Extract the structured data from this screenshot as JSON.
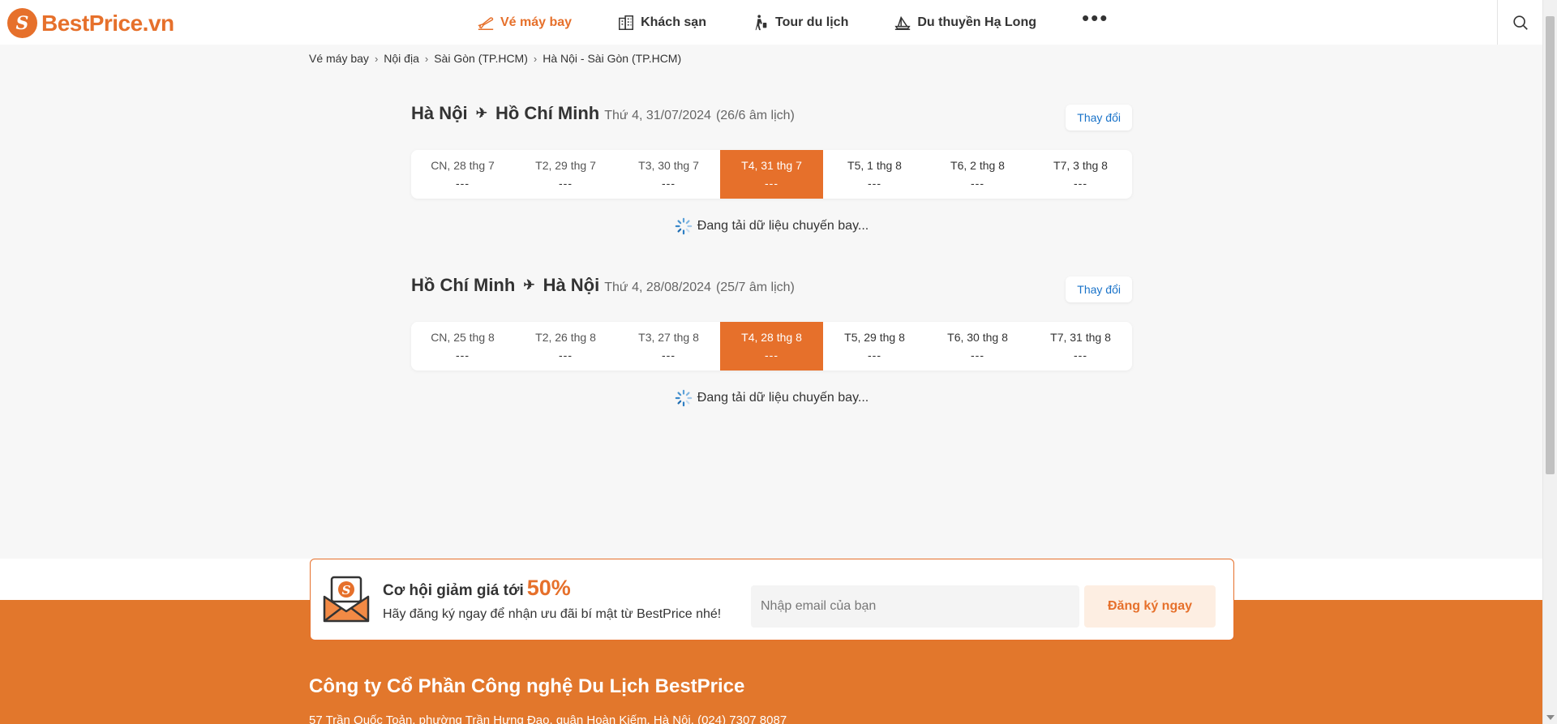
{
  "brand": {
    "name": "BestPrice.vn",
    "logo_letter": "S"
  },
  "nav": {
    "items": [
      {
        "label": "Vé máy bay",
        "icon": "plane-ticket-icon",
        "active": true
      },
      {
        "label": "Khách sạn",
        "icon": "hotel-building-icon",
        "active": false
      },
      {
        "label": "Tour du lịch",
        "icon": "traveler-luggage-icon",
        "active": false
      },
      {
        "label": "Du thuyền Hạ Long",
        "icon": "cruise-ship-icon",
        "active": false
      }
    ],
    "more_label": "•••",
    "search_icon": "search-icon"
  },
  "breadcrumb": [
    "Vé máy bay",
    "Nội địa",
    "Sài Gòn (TP.HCM)",
    "Hà Nội - Sài Gòn (TP.HCM)"
  ],
  "flights": [
    {
      "from": "Hà Nội",
      "to": "Hồ Chí Minh",
      "date": "Thứ 4, 31/07/2024",
      "lunar": "(26/6 âm lịch)",
      "change_label": "Thay đổi",
      "days": [
        {
          "label": "CN, 28 thg 7",
          "price": "---",
          "selected": false
        },
        {
          "label": "T2, 29 thg 7",
          "price": "---",
          "selected": false
        },
        {
          "label": "T3, 30 thg 7",
          "price": "---",
          "selected": false
        },
        {
          "label": "T4, 31 thg 7",
          "price": "---",
          "selected": true
        },
        {
          "label": "T5, 1 thg 8",
          "price": "---",
          "selected": false
        },
        {
          "label": "T6, 2 thg 8",
          "price": "---",
          "selected": false
        },
        {
          "label": "T7, 3 thg 8",
          "price": "---",
          "selected": false
        }
      ],
      "loading_text": "Đang tải dữ liệu chuyến bay..."
    },
    {
      "from": "Hồ Chí Minh",
      "to": "Hà Nội",
      "date": "Thứ 4, 28/08/2024",
      "lunar": "(25/7 âm lịch)",
      "change_label": "Thay đổi",
      "days": [
        {
          "label": "CN, 25 thg 8",
          "price": "---",
          "selected": false
        },
        {
          "label": "T2, 26 thg 8",
          "price": "---",
          "selected": false
        },
        {
          "label": "T3, 27 thg 8",
          "price": "---",
          "selected": false
        },
        {
          "label": "T4, 28 thg 8",
          "price": "---",
          "selected": true
        },
        {
          "label": "T5, 29 thg 8",
          "price": "---",
          "selected": false
        },
        {
          "label": "T6, 30 thg 8",
          "price": "---",
          "selected": false
        },
        {
          "label": "T7, 31 thg 8",
          "price": "---",
          "selected": false
        }
      ],
      "loading_text": "Đang tải dữ liệu chuyến bay..."
    }
  ],
  "newsletter": {
    "title": "Cơ hội giảm giá tới",
    "percent": "50%",
    "subtitle": "Hãy đăng ký ngay để nhận ưu đãi bí mật từ BestPrice nhé!",
    "email_placeholder": "Nhập email của bạn",
    "button_label": "Đăng ký ngay"
  },
  "footer": {
    "company": "Công ty Cổ Phần Công nghệ Du Lịch BestPrice",
    "address": "57 Trần Quốc Toản, phường Trần Hưng Đạo, quận Hoàn Kiếm, Hà Nội. (024) 7307 8087"
  },
  "colors": {
    "brand": "#e6702b",
    "link": "#1a73c9",
    "footer_bg": "#e2772c"
  }
}
